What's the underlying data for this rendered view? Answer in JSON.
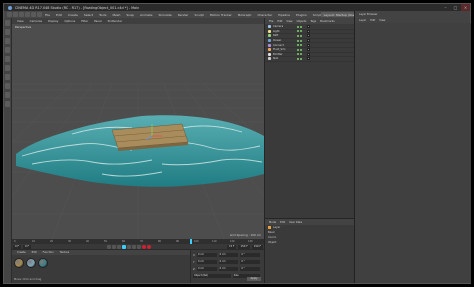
{
  "window": {
    "title": "CINEMA 4D R17.048 Studio (RC - R17) - [floatingObject_001.c4d *] - Main",
    "controls": [
      "–",
      "□",
      "×"
    ]
  },
  "menubar": {
    "items": [
      "File",
      "Edit",
      "Create",
      "Select",
      "Tools",
      "Mesh",
      "Snap",
      "Animate",
      "Simulate",
      "Render",
      "Sculpt",
      "Motion Tracker",
      "MoGraph",
      "Character",
      "Pipeline",
      "Plugins",
      "Script",
      "Window",
      "Help"
    ],
    "layout_label": "Layout: Startup (User)"
  },
  "viewport": {
    "menu": [
      "View",
      "Cameras",
      "Display",
      "Options",
      "Filter",
      "Panel",
      "ProRender"
    ],
    "label": "Perspective",
    "grid_label": "Grid Spacing : 100 cm",
    "colors": {
      "water_deep": "#1f7d83",
      "water_light": "#59aeb2",
      "foam": "#e6f2f1",
      "raft": "#a98c5c",
      "background": "#4d4d4d"
    }
  },
  "timeline": {
    "ticks": [
      "0",
      "10",
      "20",
      "30",
      "40",
      "50",
      "60",
      "70",
      "80",
      "90",
      "100",
      "110",
      "120",
      "130"
    ],
    "current_frame": "0 F",
    "start": "0 F",
    "end": "150 F",
    "end2": "150 F",
    "frame_readout": "72 F"
  },
  "material_manager": {
    "menu": [
      "Create",
      "Edit",
      "Function",
      "Texture"
    ],
    "materials": [
      {
        "name": "Mat",
        "color": "#a7894f"
      },
      {
        "name": "Mat",
        "color": "#7fa6b8"
      },
      {
        "name": "Mat",
        "color": "#3e7f86"
      }
    ],
    "label": "Move: Click and drag"
  },
  "coordinates": {
    "rows": [
      {
        "axis": "X",
        "pos": "0 cm",
        "size": "0 cm",
        "rot": "0 °"
      },
      {
        "axis": "Y",
        "pos": "0 cm",
        "size": "0 cm",
        "rot": "0 °"
      },
      {
        "axis": "Z",
        "pos": "0 cm",
        "size": "0 cm",
        "rot": "0 °"
      }
    ],
    "mode_left": "Object (Rel)",
    "mode_mid": "Size",
    "apply": "Apply"
  },
  "object_manager": {
    "menu": [
      "File",
      "Edit",
      "View",
      "Objects",
      "Tags",
      "Bookmarks"
    ],
    "objects": [
      {
        "name": "Camera",
        "color": "#9ec6e8"
      },
      {
        "name": "Light",
        "color": "#f0e08a"
      },
      {
        "name": "Raft",
        "color": "#8fd27b"
      },
      {
        "name": "Ocean",
        "color": "#6ea2d9"
      },
      {
        "name": "Connect",
        "color": "#b38ee0"
      },
      {
        "name": "Fluid_Sim",
        "color": "#f0a85a"
      },
      {
        "name": "Emitter",
        "color": "#e0e0e0"
      },
      {
        "name": "Null",
        "color": "#cfcfcf"
      }
    ]
  },
  "attribute_manager": {
    "menu": [
      "Mode",
      "Edit",
      "User Data"
    ],
    "rows": [
      "Layer",
      "Basic",
      "Coord.",
      "Object"
    ]
  },
  "right_panel": {
    "menu": [
      "Layer",
      "Edit",
      "View"
    ],
    "title": "Layer Browser"
  }
}
